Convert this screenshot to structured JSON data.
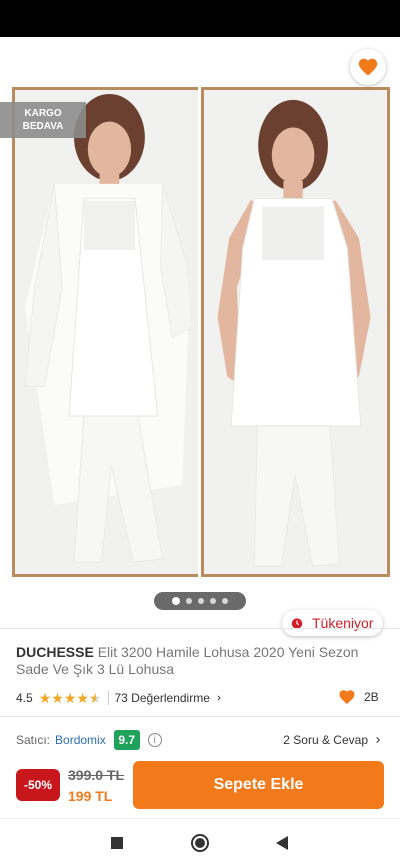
{
  "badges": {
    "shipping": "KARGO\nBEDAVA",
    "stock": "Tükeniyor"
  },
  "product": {
    "brand": "DUCHESSE",
    "name": "Elit 3200 Hamile Lohusa 2020 Yeni Sezon Sade Ve Şık 3 Lü Lohusa",
    "rating": "4.5",
    "rating_value": 4.5,
    "reviews_label": "73 Değerlendirme",
    "favorites": "2B",
    "carousel_pages": 5,
    "carousel_active": 1
  },
  "seller": {
    "label": "Satıcı:",
    "name": "Bordomix",
    "score": "9.7",
    "score_color": "#1fa25a",
    "qa_label": "2 Soru & Cevap"
  },
  "pricing": {
    "discount": "-50%",
    "old_price": "399.0 TL",
    "new_price": "199 TL",
    "add_to_cart": "Sepete Ekle"
  },
  "colors": {
    "accent": "#f27a1a",
    "discount_red": "#c8161d",
    "link_blue": "#2d6fb3"
  },
  "icons": [
    "arrow-left-icon",
    "share-icon",
    "heart-icon",
    "alarm-icon",
    "chevron-right-icon",
    "info-icon",
    "nav-recents-icon",
    "nav-home-icon",
    "nav-back-icon"
  ]
}
